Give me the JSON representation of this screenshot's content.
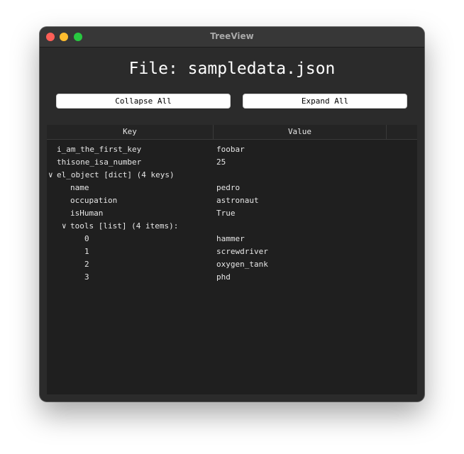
{
  "window": {
    "title": "TreeView"
  },
  "file_title": "File: sampledata.json",
  "buttons": {
    "collapse_all": "Collapse All",
    "expand_all": "Expand All"
  },
  "tree": {
    "columns": [
      "Key",
      "Value",
      ""
    ],
    "rows": [
      {
        "key": "i_am_the_first_key",
        "value": "foobar"
      },
      {
        "key": "thisone_isa_number",
        "value": "25"
      },
      {
        "key": "el_object [dict] (4 keys)",
        "value": "",
        "expand_arrow": "∨"
      },
      {
        "key": "name",
        "value": "pedro"
      },
      {
        "key": "occupation",
        "value": "astronaut"
      },
      {
        "key": "isHuman",
        "value": "True"
      },
      {
        "key": "tools [list] (4 items):",
        "value": "",
        "expand_arrow": "∨"
      },
      {
        "key": "0",
        "value": "hammer"
      },
      {
        "key": "1",
        "value": "screwdriver"
      },
      {
        "key": "2",
        "value": "oxygen_tank"
      },
      {
        "key": "3",
        "value": "phd"
      }
    ]
  },
  "colors": {
    "window_bg": "#2b2b2b",
    "tree_bg": "#1f1f1f",
    "close": "#ff5f57",
    "minimize": "#febc2e",
    "maximize": "#28c840"
  }
}
